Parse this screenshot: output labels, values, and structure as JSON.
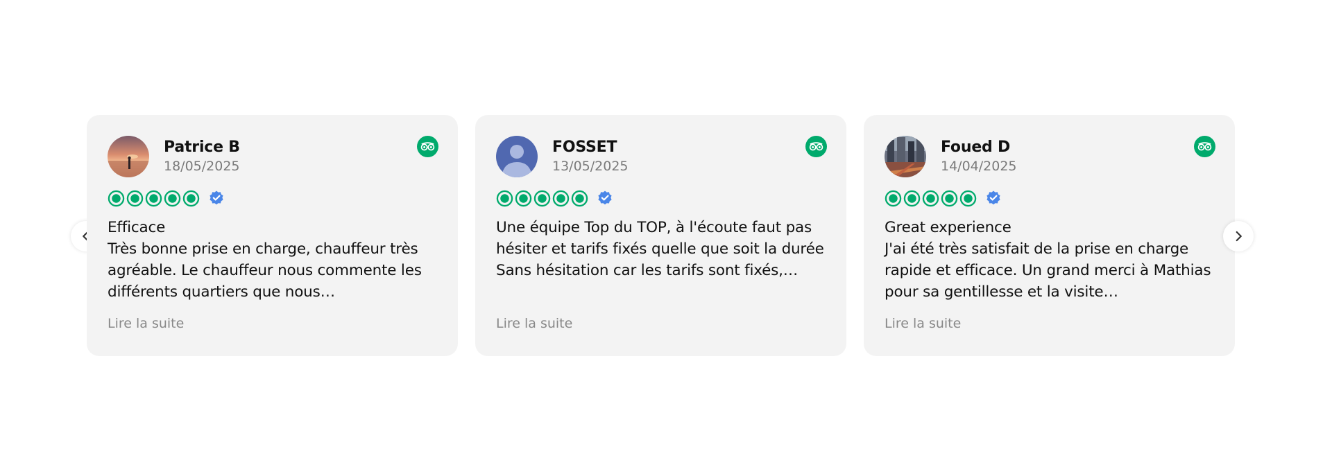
{
  "carousel": {
    "prev_icon": "chevron-left-icon",
    "next_icon": "chevron-right-icon",
    "source_icon": "tripadvisor-icon",
    "verified_icon": "verified-check-icon",
    "rating_max": 5,
    "colors": {
      "card_bg": "#f3f3f3",
      "rating_green": "#00aa6c",
      "tripadvisor_green": "#00aa6c",
      "verified_blue": "#4a86e8",
      "muted_text": "#7a7a7a"
    },
    "reviews": [
      {
        "name": "Patrice B",
        "date": "18/05/2025",
        "rating": 5,
        "body": "Efficace\nTrès bonne prise en charge, chauffeur très agréable. Le chauffeur nous commente les différents quartiers que nous…",
        "read_more": "Lire la suite"
      },
      {
        "name": "FOSSET",
        "date": "13/05/2025",
        "rating": 5,
        "body": "Une équipe Top du TOP, à l'écoute faut pas hésiter et tarifs fixés quelle que soit la durée\nSans hésitation car les tarifs sont fixés,…",
        "read_more": "Lire la suite"
      },
      {
        "name": "Foued D",
        "date": "14/04/2025",
        "rating": 5,
        "body": "Great experience\nJ'ai été très satisfait de la prise en charge rapide et efficace. Un grand merci à Mathias pour sa gentillesse et la visite…",
        "read_more": "Lire la suite"
      }
    ]
  }
}
